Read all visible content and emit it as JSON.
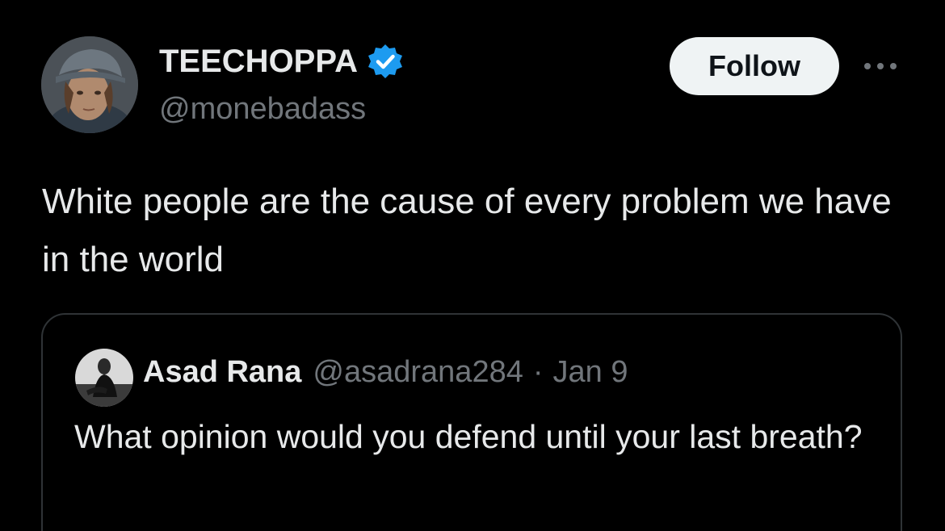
{
  "author": {
    "display_name": "TEECHOPPA",
    "handle": "@monebadass",
    "verified": true,
    "avatar": "cartoon-girl-avatar"
  },
  "actions": {
    "follow_label": "Follow",
    "more_icon": "ellipsis-icon"
  },
  "tweet": {
    "text": "White people are the cause of every problem we have in the world"
  },
  "quoted_tweet": {
    "display_name": "Asad Rana",
    "handle": "@asadrana284",
    "separator": "·",
    "date": "Jan 9",
    "text": "What opinion would you defend until your last breath?",
    "avatar": "person-photo-avatar"
  },
  "colors": {
    "background": "#000000",
    "primary_text": "#e7e9ea",
    "secondary_text": "#71767b",
    "verified_badge": "#1d9bf0",
    "follow_button_bg": "#eff3f4",
    "border": "#2f3336"
  }
}
